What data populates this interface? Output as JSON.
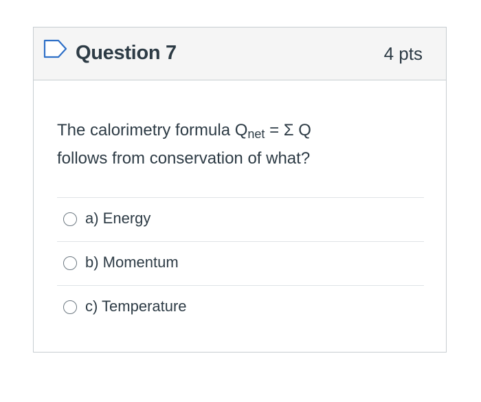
{
  "question": {
    "title": "Question 7",
    "points": "4 pts",
    "text_before_sub": "The calorimetry formula Q",
    "subscript": "net",
    "text_after_sub": " = Σ Q",
    "text_line2": "follows from conservation of what?"
  },
  "answers": [
    {
      "label": "a) Energy"
    },
    {
      "label": "b) Momentum"
    },
    {
      "label": "c) Temperature"
    }
  ],
  "colors": {
    "flag_accent": "#2d6fc7",
    "text": "#2d3b45",
    "header_bg": "#f5f5f5",
    "border": "#c7cdd1"
  }
}
